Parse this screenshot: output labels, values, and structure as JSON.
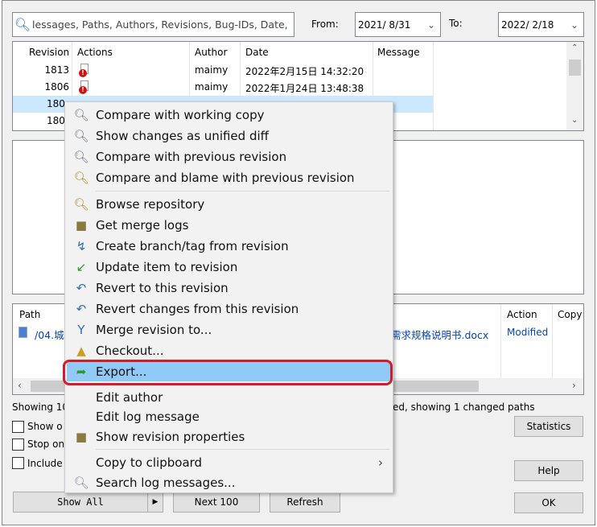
{
  "filter": {
    "placeholder": "lessages, Paths, Authors, Revisions, Bug-IDs, Date,",
    "from_label": "From:",
    "from_value": "2021/ 8/31",
    "to_label": "To:",
    "to_value": "2022/ 2/18"
  },
  "log": {
    "columns": [
      "Revision",
      "Actions",
      "Author",
      "Date",
      "Message"
    ],
    "rows": [
      {
        "revision": "1813",
        "author": "maimy",
        "date": "2022年2月15日 14:32:20"
      },
      {
        "revision": "1806",
        "author": "maimy",
        "date": "2022年1月24日 13:48:38"
      },
      {
        "revision": "180",
        "author": "",
        "date": ""
      },
      {
        "revision": "180",
        "author": "",
        "date": ""
      }
    ]
  },
  "paths": {
    "columns": [
      "Path",
      "Action",
      "Copy"
    ],
    "row": {
      "path_start": "/04.城",
      "path_end": "需求规格说明书.docx",
      "action": "Modified"
    }
  },
  "status": {
    "left": "Showing 10",
    "right": "ed, showing 1 changed paths"
  },
  "checkboxes": [
    "Show o",
    "Stop on",
    "Include"
  ],
  "buttons": {
    "statistics": "Statistics",
    "help": "Help",
    "ok": "OK",
    "show_all": "Show All",
    "next": "Next 100",
    "refresh": "Refresh"
  },
  "menu": {
    "items": [
      {
        "label": "Compare with working copy",
        "icon": "magnifier-icon"
      },
      {
        "label": "Show changes as unified diff",
        "icon": "magnifier-icon"
      },
      {
        "label": "Compare with previous revision",
        "icon": "magnifier-icon"
      },
      {
        "label": "Compare and blame with previous revision",
        "icon": "blame-icon"
      },
      {
        "label": "Browse repository",
        "icon": "repo-browser-icon"
      },
      {
        "label": "Get merge logs",
        "icon": "merge-log-icon"
      },
      {
        "label": "Create branch/tag from revision",
        "icon": "branch-icon"
      },
      {
        "label": "Update item to revision",
        "icon": "update-icon"
      },
      {
        "label": "Revert to this revision",
        "icon": "revert-icon"
      },
      {
        "label": "Revert changes from this revision",
        "icon": "revert-icon"
      },
      {
        "label": "Merge revision to...",
        "icon": "merge-icon"
      },
      {
        "label": "Checkout...",
        "icon": "checkout-icon"
      },
      {
        "label": "Export...",
        "icon": "export-icon"
      },
      {
        "label": "Edit author",
        "icon": ""
      },
      {
        "label": "Edit log message",
        "icon": ""
      },
      {
        "label": "Show revision properties",
        "icon": "properties-icon"
      },
      {
        "label": "Copy to clipboard",
        "icon": ""
      },
      {
        "label": "Search log messages...",
        "icon": "search-icon"
      }
    ],
    "highlighted": "Export..."
  },
  "colors": {
    "selection": "#cce8ff",
    "menu_highlight": "#91c9f7",
    "annotation": "#d31d2a",
    "link": "#0645ad"
  }
}
